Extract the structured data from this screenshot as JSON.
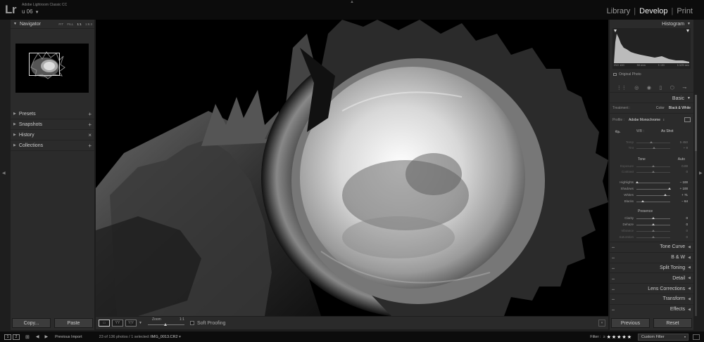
{
  "app": {
    "logo": "Lr",
    "product": "Adobe Lightroom Classic CC",
    "user": "u 06",
    "modules": [
      "Library",
      "Develop",
      "Print"
    ],
    "active_module": "Develop"
  },
  "left_panel": {
    "navigator_title": "Navigator",
    "zoom_options": [
      "FIT",
      "FILL",
      "1:1",
      "1:8.3"
    ],
    "panels": [
      {
        "label": "Presets",
        "action": "+"
      },
      {
        "label": "Snapshots",
        "action": "+"
      },
      {
        "label": "History",
        "action": "×"
      },
      {
        "label": "Collections",
        "action": "+"
      }
    ],
    "copy_button": "Copy...",
    "paste_button": "Paste"
  },
  "toolbar": {
    "zoom_label": "Zoom",
    "zoom_value": "1:1",
    "zoom_level": 0.5,
    "soft_proofing": "Soft Proofing"
  },
  "right_panel": {
    "histogram_title": "Histogram",
    "meta": [
      "ISO 100",
      "50 mm",
      "f / 20",
      "1/125 sec"
    ],
    "original_photo": "Original Photo",
    "basic_title": "Basic",
    "treatment_label": "Treatment :",
    "treatment_color": "Color",
    "treatment_bw": "Black & White",
    "profile_label": "Profile :",
    "profile_value": "Adobe Monochrome",
    "wb_label": "WB :",
    "wb_value": "As Shot",
    "sliders_wb": [
      {
        "label": "Temp",
        "value": "5 450",
        "pos": 0.44,
        "disabled": true
      },
      {
        "label": "Tint",
        "value": "+ 9",
        "pos": 0.52,
        "disabled": true
      }
    ],
    "tone_label": "Tone",
    "tone_auto": "Auto",
    "sliders_tone": [
      {
        "label": "Exposure",
        "value": "0.00",
        "pos": 0.5,
        "disabled": true
      },
      {
        "label": "Contrast",
        "value": "0",
        "pos": 0.5,
        "disabled": true
      }
    ],
    "sliders_tone2": [
      {
        "label": "Highlights",
        "value": "− 100",
        "pos": 0.02
      },
      {
        "label": "Shadows",
        "value": "+ 100",
        "pos": 0.98
      },
      {
        "label": "Whites",
        "value": "+ 71",
        "pos": 0.85
      },
      {
        "label": "Blacks",
        "value": "− 64",
        "pos": 0.18
      }
    ],
    "presence_label": "Presence",
    "sliders_presence": [
      {
        "label": "Clarity",
        "value": "0",
        "pos": 0.5
      },
      {
        "label": "Dehaze",
        "value": "0",
        "pos": 0.5
      },
      {
        "label": "Vibrance",
        "value": "0",
        "pos": 0.5,
        "disabled": true
      },
      {
        "label": "Saturation",
        "value": "0",
        "pos": 0.5,
        "disabled": true
      }
    ],
    "collapsed_panels": [
      "Tone Curve",
      "B & W",
      "Split Toning",
      "Detail",
      "Lens Corrections",
      "Transform",
      "Effects"
    ],
    "previous_button": "Previous",
    "reset_button": "Reset"
  },
  "filmstrip": {
    "screen1": "1",
    "screen2": "2",
    "source": "Previous Import",
    "count": "23 of 136 photos / 1 selected /",
    "filename": "IMG_0013.CR2",
    "filter_label": "Filter :",
    "filter_op": "≥",
    "stars": "★★★★★",
    "custom_filter": "Custom Filter"
  },
  "colors": {
    "panel": "#2b2b2b",
    "background": "#1e1e1e",
    "active_text": "#eeeeee"
  },
  "icons": {
    "develop_tools": [
      "crop-icon",
      "spot-removal-icon",
      "red-eye-icon",
      "graduated-filter-icon",
      "radial-filter-icon",
      "adjustment-brush-icon"
    ]
  }
}
